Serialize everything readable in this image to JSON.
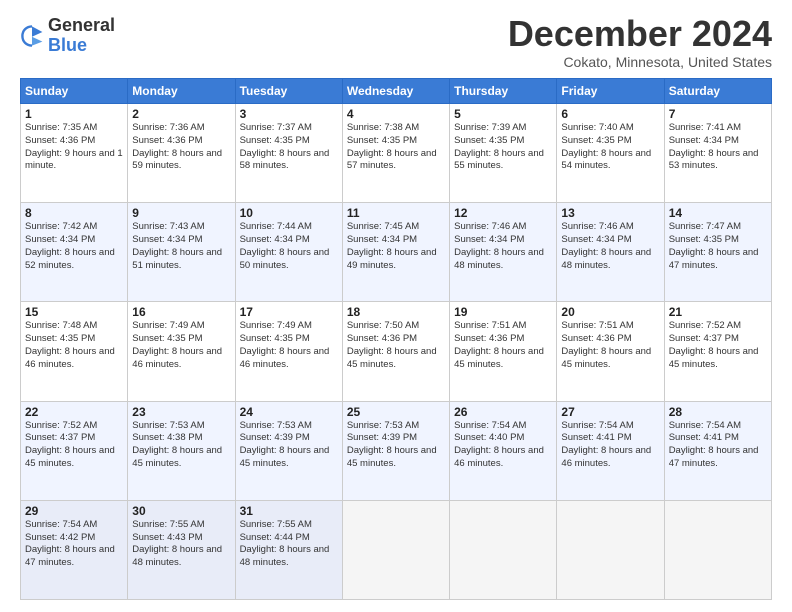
{
  "logo": {
    "general": "General",
    "blue": "Blue"
  },
  "header": {
    "month": "December 2024",
    "location": "Cokato, Minnesota, United States"
  },
  "weekdays": [
    "Sunday",
    "Monday",
    "Tuesday",
    "Wednesday",
    "Thursday",
    "Friday",
    "Saturday"
  ],
  "weeks": [
    [
      {
        "day": 1,
        "sunrise": "7:35 AM",
        "sunset": "4:36 PM",
        "daylight": "9 hours and 1 minute."
      },
      {
        "day": 2,
        "sunrise": "7:36 AM",
        "sunset": "4:36 PM",
        "daylight": "8 hours and 59 minutes."
      },
      {
        "day": 3,
        "sunrise": "7:37 AM",
        "sunset": "4:35 PM",
        "daylight": "8 hours and 58 minutes."
      },
      {
        "day": 4,
        "sunrise": "7:38 AM",
        "sunset": "4:35 PM",
        "daylight": "8 hours and 57 minutes."
      },
      {
        "day": 5,
        "sunrise": "7:39 AM",
        "sunset": "4:35 PM",
        "daylight": "8 hours and 55 minutes."
      },
      {
        "day": 6,
        "sunrise": "7:40 AM",
        "sunset": "4:35 PM",
        "daylight": "8 hours and 54 minutes."
      },
      {
        "day": 7,
        "sunrise": "7:41 AM",
        "sunset": "4:34 PM",
        "daylight": "8 hours and 53 minutes."
      }
    ],
    [
      {
        "day": 8,
        "sunrise": "7:42 AM",
        "sunset": "4:34 PM",
        "daylight": "8 hours and 52 minutes."
      },
      {
        "day": 9,
        "sunrise": "7:43 AM",
        "sunset": "4:34 PM",
        "daylight": "8 hours and 51 minutes."
      },
      {
        "day": 10,
        "sunrise": "7:44 AM",
        "sunset": "4:34 PM",
        "daylight": "8 hours and 50 minutes."
      },
      {
        "day": 11,
        "sunrise": "7:45 AM",
        "sunset": "4:34 PM",
        "daylight": "8 hours and 49 minutes."
      },
      {
        "day": 12,
        "sunrise": "7:46 AM",
        "sunset": "4:34 PM",
        "daylight": "8 hours and 48 minutes."
      },
      {
        "day": 13,
        "sunrise": "7:46 AM",
        "sunset": "4:34 PM",
        "daylight": "8 hours and 48 minutes."
      },
      {
        "day": 14,
        "sunrise": "7:47 AM",
        "sunset": "4:35 PM",
        "daylight": "8 hours and 47 minutes."
      }
    ],
    [
      {
        "day": 15,
        "sunrise": "7:48 AM",
        "sunset": "4:35 PM",
        "daylight": "8 hours and 46 minutes."
      },
      {
        "day": 16,
        "sunrise": "7:49 AM",
        "sunset": "4:35 PM",
        "daylight": "8 hours and 46 minutes."
      },
      {
        "day": 17,
        "sunrise": "7:49 AM",
        "sunset": "4:35 PM",
        "daylight": "8 hours and 46 minutes."
      },
      {
        "day": 18,
        "sunrise": "7:50 AM",
        "sunset": "4:36 PM",
        "daylight": "8 hours and 45 minutes."
      },
      {
        "day": 19,
        "sunrise": "7:51 AM",
        "sunset": "4:36 PM",
        "daylight": "8 hours and 45 minutes."
      },
      {
        "day": 20,
        "sunrise": "7:51 AM",
        "sunset": "4:36 PM",
        "daylight": "8 hours and 45 minutes."
      },
      {
        "day": 21,
        "sunrise": "7:52 AM",
        "sunset": "4:37 PM",
        "daylight": "8 hours and 45 minutes."
      }
    ],
    [
      {
        "day": 22,
        "sunrise": "7:52 AM",
        "sunset": "4:37 PM",
        "daylight": "8 hours and 45 minutes."
      },
      {
        "day": 23,
        "sunrise": "7:53 AM",
        "sunset": "4:38 PM",
        "daylight": "8 hours and 45 minutes."
      },
      {
        "day": 24,
        "sunrise": "7:53 AM",
        "sunset": "4:39 PM",
        "daylight": "8 hours and 45 minutes."
      },
      {
        "day": 25,
        "sunrise": "7:53 AM",
        "sunset": "4:39 PM",
        "daylight": "8 hours and 45 minutes."
      },
      {
        "day": 26,
        "sunrise": "7:54 AM",
        "sunset": "4:40 PM",
        "daylight": "8 hours and 46 minutes."
      },
      {
        "day": 27,
        "sunrise": "7:54 AM",
        "sunset": "4:41 PM",
        "daylight": "8 hours and 46 minutes."
      },
      {
        "day": 28,
        "sunrise": "7:54 AM",
        "sunset": "4:41 PM",
        "daylight": "8 hours and 47 minutes."
      }
    ],
    [
      {
        "day": 29,
        "sunrise": "7:54 AM",
        "sunset": "4:42 PM",
        "daylight": "8 hours and 47 minutes."
      },
      {
        "day": 30,
        "sunrise": "7:55 AM",
        "sunset": "4:43 PM",
        "daylight": "8 hours and 48 minutes."
      },
      {
        "day": 31,
        "sunrise": "7:55 AM",
        "sunset": "4:44 PM",
        "daylight": "8 hours and 48 minutes."
      },
      null,
      null,
      null,
      null
    ]
  ]
}
